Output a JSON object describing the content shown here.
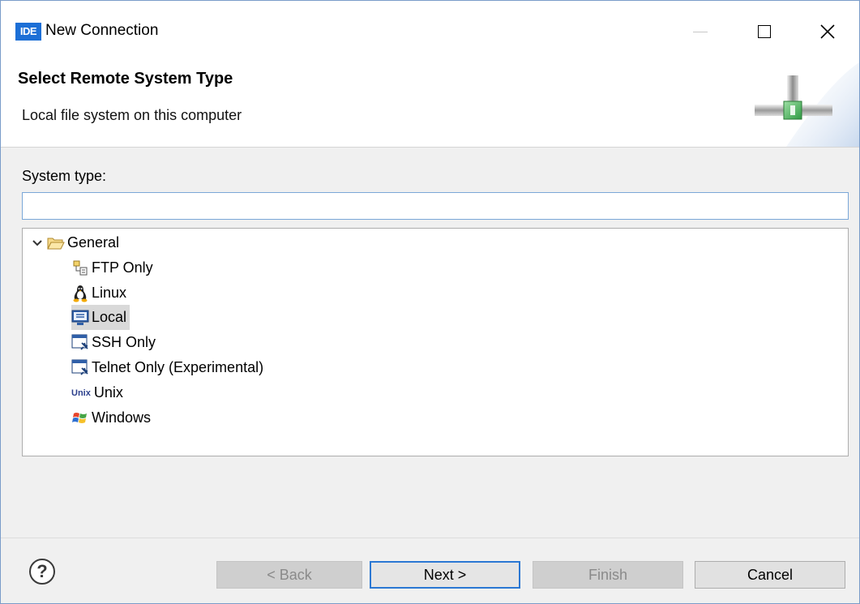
{
  "window": {
    "app_badge": "IDE",
    "title": "New Connection"
  },
  "banner": {
    "heading": "Select Remote System Type",
    "description": "Local file system on this computer"
  },
  "form": {
    "system_type_label": "System type:",
    "filter_value": "",
    "filter_placeholder": ""
  },
  "tree": {
    "root": {
      "label": "General",
      "icon": "open-folder-icon",
      "expanded": true
    },
    "items": [
      {
        "label": "FTP Only",
        "icon": "ftp-icon"
      },
      {
        "label": "Linux",
        "icon": "linux-penguin-icon"
      },
      {
        "label": "Local",
        "icon": "local-computer-icon",
        "selected": true
      },
      {
        "label": "SSH Only",
        "icon": "ssh-terminal-icon"
      },
      {
        "label": "Telnet Only (Experimental)",
        "icon": "telnet-terminal-icon"
      },
      {
        "label": "Unix",
        "icon": "unix-icon",
        "icon_text": "Unix"
      },
      {
        "label": "Windows",
        "icon": "windows-icon"
      }
    ]
  },
  "footer": {
    "help": "?",
    "back": "< Back",
    "next": "Next >",
    "finish": "Finish",
    "cancel": "Cancel"
  },
  "colors": {
    "accent": "#1c6fd6",
    "selection": "#d9d9d9",
    "default_button_border": "#2b78d3"
  }
}
